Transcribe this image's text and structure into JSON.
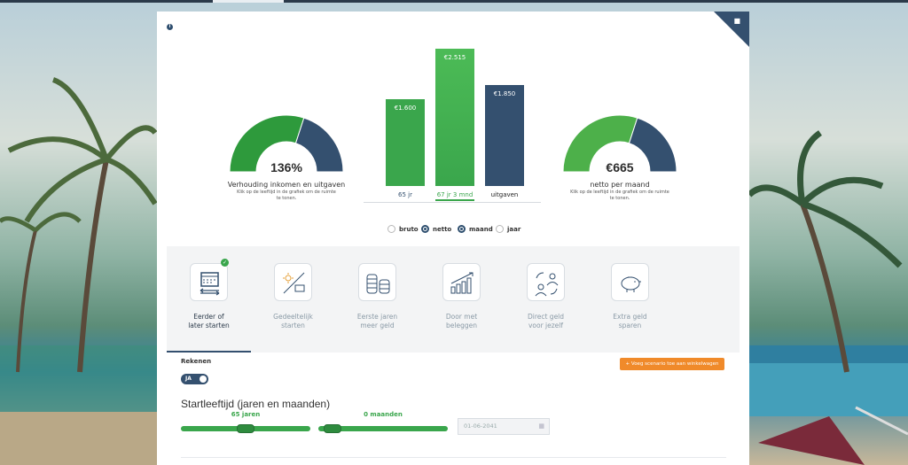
{
  "colors": {
    "green": "#3aa64c",
    "dark_green": "#2e8b3e",
    "navy": "#34506f",
    "orange": "#f08a2a"
  },
  "gauge_left": {
    "value": "136%",
    "label": "Verhouding inkomen en uitgaven",
    "note": "Klik op de leeftijd in de grafiek om de ruimte te tonen.",
    "green_fraction": 0.6
  },
  "gauge_right": {
    "value": "€665",
    "label": "netto per maand",
    "note": "Klik op de leeftijd in de grafiek om de ruimte te tonen.",
    "green_fraction": 0.6
  },
  "chart_data": {
    "type": "bar",
    "categories": [
      "65 jr",
      "67 jr 3 mnd",
      "uitgaven"
    ],
    "values": [
      1600,
      2515,
      1850
    ],
    "value_labels": [
      "€1.600",
      "€2.515",
      "€1.850"
    ],
    "colors": [
      "#3aa64c",
      "#3aa64c",
      "#34506f"
    ],
    "ylim": [
      0,
      2600
    ]
  },
  "radios": [
    {
      "label": "bruto",
      "selected": false
    },
    {
      "label": "netto",
      "selected": true
    },
    {
      "label": "maand",
      "selected": true
    },
    {
      "label": "jaar",
      "selected": false
    }
  ],
  "features": [
    {
      "label1": "Eerder of",
      "label2": "later starten",
      "icon": "calendar-icon",
      "active": true
    },
    {
      "label1": "Gedeeltelijk",
      "label2": "starten",
      "icon": "sun-briefcase-icon",
      "active": false
    },
    {
      "label1": "Eerste jaren",
      "label2": "meer geld",
      "icon": "coin-stack-icon",
      "active": false
    },
    {
      "label1": "Door met",
      "label2": "beleggen",
      "icon": "growth-chart-icon",
      "active": false
    },
    {
      "label1": "Direct geld",
      "label2": "voor jezelf",
      "icon": "person-exchange-icon",
      "active": false
    },
    {
      "label1": "Extra geld",
      "label2": "sparen",
      "icon": "piggy-bank-icon",
      "active": false
    }
  ],
  "rekenen": {
    "label": "Rekenen",
    "toggle_label": "JA"
  },
  "scenario_button": "+ Voeg scenario toe aan winkelwagen",
  "start_title": "Startleeftijd (jaren en maanden)",
  "slider_years": {
    "value": "65 jaren",
    "fraction": 0.5
  },
  "slider_months": {
    "value": "0 maanden",
    "fraction": 0.0
  },
  "date_input": {
    "placeholder": "01-06-2041"
  }
}
